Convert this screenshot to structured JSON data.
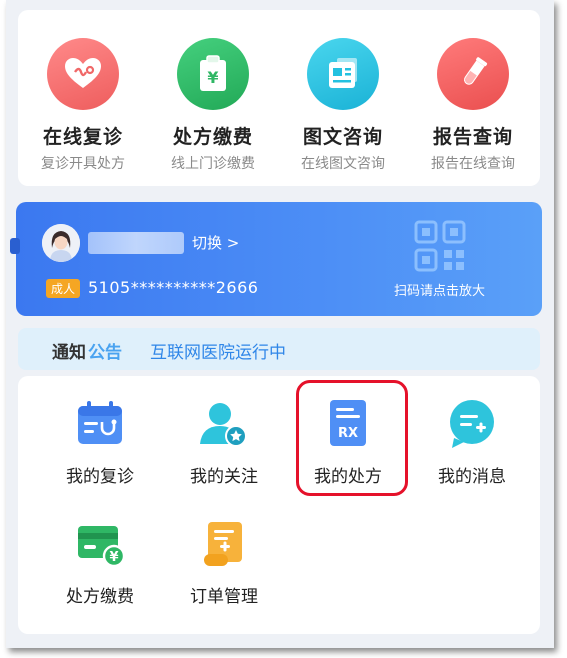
{
  "services": [
    {
      "title": "在线复诊",
      "subtitle": "复诊开具处方",
      "icon": "heart-pulse-icon",
      "color": "#f06868"
    },
    {
      "title": "处方缴费",
      "subtitle": "线上门诊缴费",
      "icon": "bill-yen-icon",
      "color": "#2fb765"
    },
    {
      "title": "图文咨询",
      "subtitle": "在线图文咨询",
      "icon": "document-image-icon",
      "color": "#23c1e0"
    },
    {
      "title": "报告查询",
      "subtitle": "报告在线查询",
      "icon": "test-tube-icon",
      "color": "#ee5a5a"
    }
  ],
  "patient_card": {
    "switch_label": "切换 >",
    "badge": "成人",
    "card_number": "5105**********2666",
    "qr_hint": "扫码请点击放大"
  },
  "notice": {
    "label_part1": "通知",
    "label_part2": "公告",
    "text": "互联网医院运行中"
  },
  "menu": [
    {
      "label": "我的复诊",
      "icon": "calendar-stethoscope-icon"
    },
    {
      "label": "我的关注",
      "icon": "user-star-icon"
    },
    {
      "label": "我的处方",
      "icon": "prescription-rx-icon"
    },
    {
      "label": "我的消息",
      "icon": "message-plus-icon"
    },
    {
      "label": "处方缴费",
      "icon": "card-yen-icon"
    },
    {
      "label": "订单管理",
      "icon": "order-scroll-icon"
    }
  ]
}
